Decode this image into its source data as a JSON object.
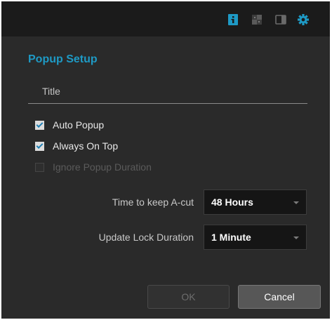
{
  "toolbar": {
    "icons": [
      "info-icon",
      "grid-icon",
      "panel-icon",
      "gear-icon"
    ],
    "accent": "#1e9ac5"
  },
  "dialog": {
    "title": "Popup Setup",
    "title_field": {
      "placeholder": "Title",
      "value": ""
    },
    "checkboxes": [
      {
        "label": "Auto Popup",
        "checked": true,
        "disabled": false
      },
      {
        "label": "Always On Top",
        "checked": true,
        "disabled": false
      },
      {
        "label": "Ignore Popup Duration",
        "checked": false,
        "disabled": true
      }
    ],
    "fields": [
      {
        "label": "Time to keep A-cut",
        "value": "48 Hours"
      },
      {
        "label": "Update Lock Duration",
        "value": "1 Minute"
      }
    ],
    "buttons": {
      "ok": "OK",
      "cancel": "Cancel",
      "ok_disabled": true
    }
  }
}
